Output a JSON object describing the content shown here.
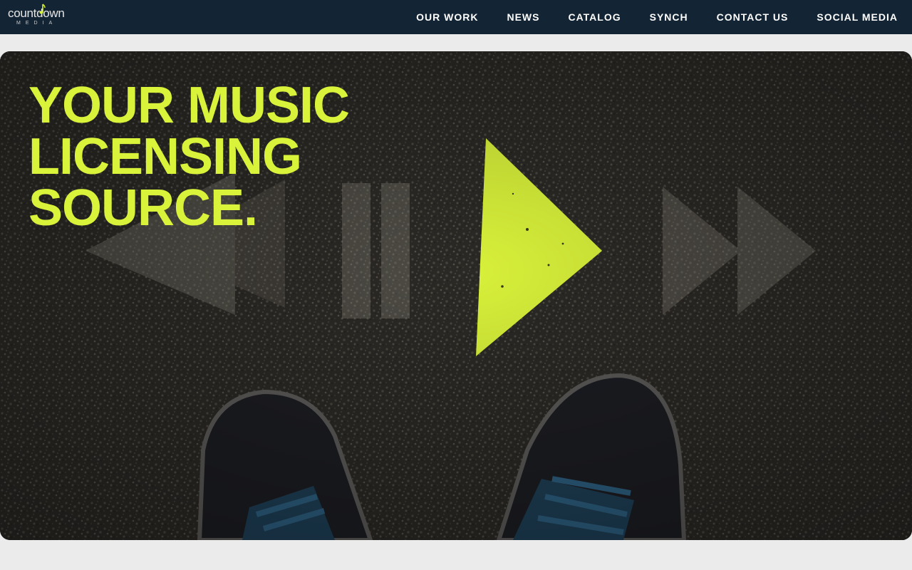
{
  "brand": {
    "name": "countdown",
    "sub": "MEDIA",
    "accent": "#d9f23a",
    "header_bg": "#132535"
  },
  "nav": {
    "items": [
      {
        "label": "OUR WORK"
      },
      {
        "label": "NEWS"
      },
      {
        "label": "CATALOG"
      },
      {
        "label": "SYNCH"
      },
      {
        "label": "CONTACT US"
      },
      {
        "label": "SOCIAL MEDIA"
      }
    ]
  },
  "hero": {
    "title_lines": [
      "YOUR MUSIC",
      "LICENSING",
      "SOURCE."
    ],
    "image_description_icons": [
      "rewind-icon",
      "pause-icon",
      "play-icon",
      "fast-forward-icon",
      "sneaker-icon"
    ]
  }
}
